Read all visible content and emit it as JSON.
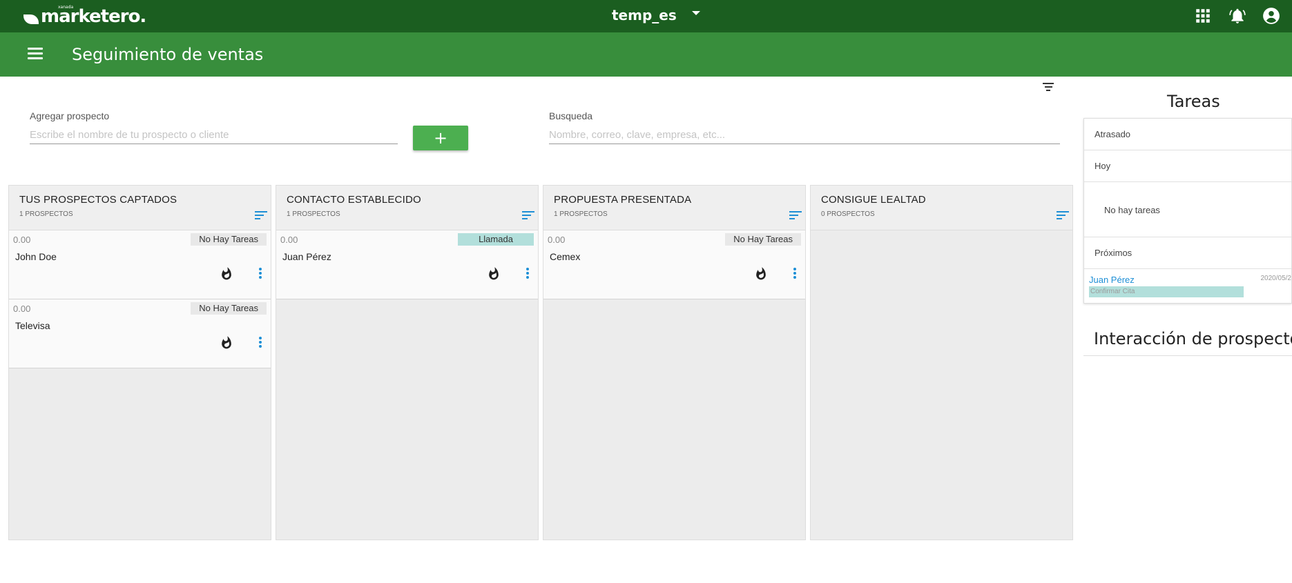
{
  "topbar": {
    "logo_text": "marketero.",
    "logo_small": "xanada",
    "account_name": "temp_es",
    "icons": [
      "apps-grid-icon",
      "notification-bell-icon",
      "account-circle-icon"
    ]
  },
  "appbar": {
    "title": "Seguimiento de ventas"
  },
  "add_prospect": {
    "label": "Agregar prospecto",
    "placeholder": "Escribe el nombre de tu prospecto o cliente",
    "value": "",
    "button_label": "+"
  },
  "search": {
    "label": "Busqueda",
    "placeholder": "Nombre, correo, clave, empresa, etc...",
    "value": ""
  },
  "columns": [
    {
      "title": "TUS PROSPECTOS CAPTADOS",
      "count": "1 PROSPECTOS",
      "cards": [
        {
          "amount": "0.00",
          "badge": "No Hay Tareas",
          "name": "John Doe"
        },
        {
          "amount": "0.00",
          "badge": "No Hay Tareas",
          "name": "Televisa"
        }
      ]
    },
    {
      "title": "CONTACTO ESTABLECIDO",
      "count": "1 PROSPECTOS",
      "cards": [
        {
          "amount": "0.00",
          "badge": "Llamada",
          "name": "Juan Pérez"
        }
      ]
    },
    {
      "title": "PROPUESTA PRESENTADA",
      "count": "1 PROSPECTOS",
      "cards": [
        {
          "amount": "0.00",
          "badge": "No Hay Tareas",
          "name": "Cemex"
        }
      ]
    },
    {
      "title": "CONSIGUE LEALTAD",
      "count": "0 PROSPECTOS",
      "cards": []
    }
  ],
  "tasks": {
    "title": "Tareas",
    "overdue_label": "Atrasado",
    "today_label": "Hoy",
    "empty_text": "No hay tareas",
    "upcoming_label": "Próximos",
    "upcoming_item": {
      "contact": "Juan Pérez",
      "date": "2020/05/2",
      "task": "Confirmar Cita"
    }
  },
  "interactions": {
    "title": "Interacción de prospectos"
  },
  "colors": {
    "topbar": "#1b5e20",
    "appbar": "#388e3c",
    "add_button": "#4caf50",
    "accent_blue": "#1e8fd6",
    "call_badge": "#b2dfdb"
  }
}
